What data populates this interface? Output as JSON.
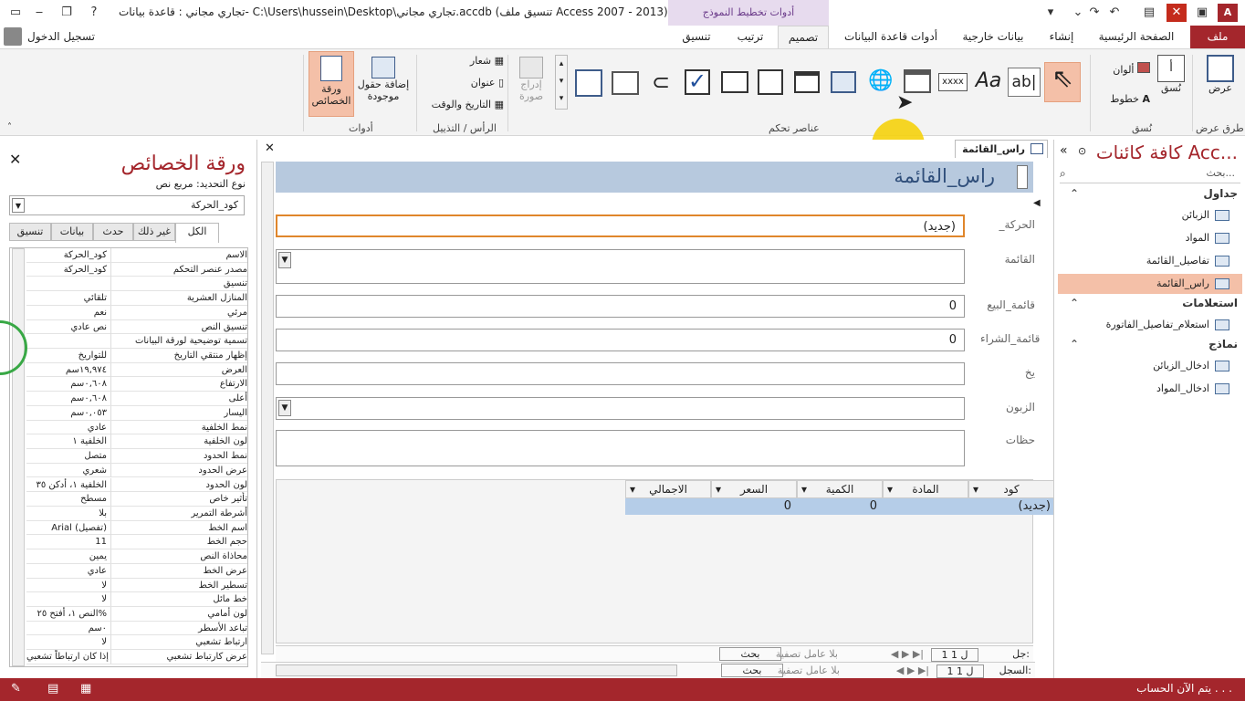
{
  "window": {
    "title": "تجاري مجاني : قاعدة بيانات- C:\\Users\\hussein\\Desktop\\تجاري مجاني.accdb (تنسيق ملف Access 2007 - 2013)...",
    "contextual_group": "أدوات تخطيط النموذج",
    "user": "تسجيل الدخول",
    "app_icon": "A",
    "help": "?"
  },
  "ribbon_tabs": {
    "file": "ملف",
    "home": "الصفحة الرئيسية",
    "create": "إنشاء",
    "external": "بيانات خارجية",
    "db_tools": "أدوات قاعدة البيانات",
    "design": "تصميم",
    "arrange": "ترتيب",
    "format": "تنسيق"
  },
  "ribbon": {
    "views_label": "طرق عرض",
    "view_btn": "عرض",
    "themes_label": "نُسق",
    "themes_btn": "نُسق",
    "colors": "ألوان",
    "fonts": "خطوط",
    "controls_label": "عناصر تحكم",
    "insert_image": "إدراج صورة",
    "header_footer_label": "الرأس / التذييل",
    "logo": "شعار",
    "title": "عنوان",
    "date_time": "التاريخ والوقت",
    "tools_label": "أدوات",
    "add_fields": "إضافة حقول موجودة",
    "property_sheet": "ورقة الخصائص",
    "ctl_label_text": "Aa",
    "ctl_textbox_text": "ab|",
    "ctl_xxxx_text": "xxxx"
  },
  "property_sheet": {
    "title": "ورقة الخصائص",
    "selection_type_label": "نوع التحديد:",
    "selection_type_value": "مربع نص",
    "selected_control": "كود_الحركة",
    "tabs": [
      "الكل",
      "غير ذلك",
      "حدث",
      "بيانات",
      "تنسيق"
    ],
    "rows": [
      {
        "name": "الاسم",
        "value": "كود_الحركة"
      },
      {
        "name": "مصدر عنصر التحكم",
        "value": "كود_الحركة"
      },
      {
        "name": "تنسيق",
        "value": ""
      },
      {
        "name": "المنازل العشرية",
        "value": "تلقائي"
      },
      {
        "name": "مرئي",
        "value": "نعم"
      },
      {
        "name": "تنسيق النص",
        "value": "نص عادي"
      },
      {
        "name": "تسمية توضيحية لورقة البيانات",
        "value": ""
      },
      {
        "name": "إظهار منتقي التاريخ",
        "value": "للتواريخ"
      },
      {
        "name": "العرض",
        "value": "١٩,٩٧٤سم"
      },
      {
        "name": "الارتفاع",
        "value": "٠,٦٠٨سم"
      },
      {
        "name": "أعلى",
        "value": "٠,٦٠٨سم"
      },
      {
        "name": "اليسار",
        "value": "٠,٠٥٣سم"
      },
      {
        "name": "نمط الخلفية",
        "value": "عادي"
      },
      {
        "name": "لون الخلفية",
        "value": "الخلفية ١"
      },
      {
        "name": "نمط الحدود",
        "value": "متصل"
      },
      {
        "name": "عرض الحدود",
        "value": "شعري"
      },
      {
        "name": "لون الحدود",
        "value": "الخلفية ١، أدكن ٣٥"
      },
      {
        "name": "تأثير خاص",
        "value": "مسطح"
      },
      {
        "name": "أشرطة التمرير",
        "value": "بلا"
      },
      {
        "name": "اسم الخط",
        "value": "Arial (تفصيل)"
      },
      {
        "name": "حجم الخط",
        "value": "11"
      },
      {
        "name": "محاذاة النص",
        "value": "يمين"
      },
      {
        "name": "عرض الخط",
        "value": "عادي"
      },
      {
        "name": "تسطير الخط",
        "value": "لا"
      },
      {
        "name": "خط مائل",
        "value": "لا"
      },
      {
        "name": "لون أمامي",
        "value": "النص ١، أفتح ٢٥%"
      },
      {
        "name": "تباعد الأسطر",
        "value": "٠سم"
      },
      {
        "name": "ارتباط تشعبي",
        "value": "لا"
      },
      {
        "name": "عرض كارتباط تشعبي",
        "value": "إذا كان ارتباطاً تشعبي"
      }
    ]
  },
  "nav_pane": {
    "title": "كافة كائنات Acc...",
    "search_placeholder": "بحث...",
    "groups": [
      {
        "header": "جداول",
        "items": [
          "الزبائن",
          "المواد",
          "تفاصيل_القائمة",
          "راس_القائمة"
        ]
      },
      {
        "header": "استعلامات",
        "items": [
          "استعلام_تفاصيل_الفاتورة"
        ]
      },
      {
        "header": "نماذج",
        "items": [
          "ادخال_الزبائن",
          "ادخال_المواد"
        ]
      }
    ],
    "selected": "راس_القائمة"
  },
  "document": {
    "tab_label": "راس_القائمة",
    "form_title": "راس_القائمة",
    "fields": [
      {
        "label": "_الحركة",
        "value": "(جديد)"
      },
      {
        "label": "القائمة",
        "value": ""
      },
      {
        "label": "قائمة_البيع",
        "value": "0"
      },
      {
        "label": "قائمة_الشراء",
        "value": "0"
      },
      {
        "label": "يخ",
        "value": ""
      },
      {
        "label": "الزبون",
        "value": ""
      },
      {
        "label": "حظات",
        "value": ""
      }
    ],
    "subform": {
      "columns": [
        "كود",
        "المادة",
        "الكمية",
        "السعر",
        "الاجمالي"
      ],
      "row": [
        "(جديد)",
        "",
        "0",
        "0",
        ""
      ]
    },
    "sub_nav": {
      "record_label": "جل:",
      "position": "1 ل 1",
      "filter": "بلا عامل تصفية",
      "search": "بحث"
    },
    "main_nav": {
      "record_label": "السجل:",
      "position": "1 ل 1",
      "filter": "بلا عامل تصفية",
      "search": "بحث"
    }
  },
  "status": {
    "text": "يتم الآن الحساب . . ."
  }
}
